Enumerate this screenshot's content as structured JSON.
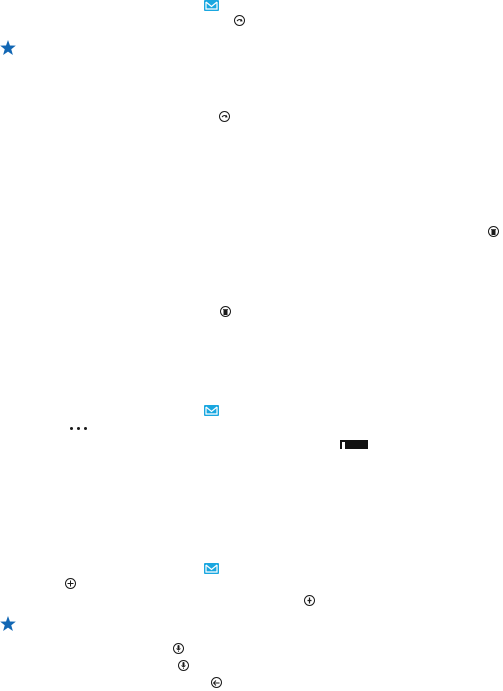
{
  "colors": {
    "accent_mail": "#1aa7e0",
    "accent_star": "#1267b4",
    "icon_stroke": "#1a1a1a"
  },
  "icons": [
    "mail-icon",
    "sync-icon",
    "star-icon",
    "delete-icon",
    "more-icon",
    "battery-icon",
    "add-icon",
    "add-attachment-icon",
    "microphone-icon",
    "reply-all-icon"
  ]
}
